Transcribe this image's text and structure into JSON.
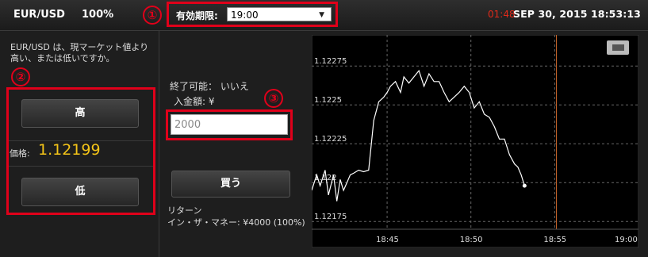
{
  "header": {
    "pair": "EUR/USD",
    "payout": "100%",
    "expiry_label": "有効期限:",
    "expiry_value": "19:00",
    "countdown": "01:48",
    "datetime": "SEP 30, 2015 18:53:13"
  },
  "markers": [
    "①",
    "②",
    "③"
  ],
  "left_panel": {
    "question": "EUR/USD は、現マーケット値より高い、または低いですか。",
    "high_label": "高",
    "price_label": "価格:",
    "price_value": "1.12199",
    "low_label": "低"
  },
  "middle_panel": {
    "expiry_possible": "終了可能： いいえ",
    "deposit_label": "入金額: ¥",
    "amount_value": "2000",
    "buy_label": "買う",
    "return_label": "リターン",
    "itm_label": "イン・ザ・マネー: ¥4000 (100%)"
  },
  "colors": {
    "accent_red": "#e0001a",
    "price_yellow": "#f5c518",
    "expiry_line": "#c8642a"
  },
  "chart_data": {
    "type": "line",
    "y_ticks": [
      "1.12275",
      "1.1225",
      "1.12225",
      "1.122",
      "1.12175"
    ],
    "y_tick_values": [
      1.12275,
      1.1225,
      1.12225,
      1.122,
      1.12175
    ],
    "x_ticks": [
      "18:45",
      "18:50",
      "18:55",
      "19:00"
    ],
    "ylim": [
      1.1217,
      1.12295
    ],
    "x_range_minutes": [
      40.5,
      60
    ],
    "expiry_marker": "19:00",
    "grid": true,
    "series": [
      {
        "x": [
          40.5,
          40.8,
          41.0,
          41.3,
          41.5,
          41.8,
          42.0,
          42.2,
          42.4,
          42.6,
          42.8,
          43.0,
          43.3,
          43.6,
          43.9,
          44.2,
          44.5,
          44.8,
          45.0,
          45.2,
          45.5,
          45.8,
          46.0,
          46.3,
          46.6,
          46.9,
          47.2,
          47.5,
          47.8,
          48.1,
          48.4,
          48.7,
          49.0,
          49.3,
          49.6,
          49.9,
          50.2,
          50.5,
          50.8,
          51.1,
          51.4,
          51.7,
          52.0,
          52.3,
          52.6,
          52.8,
          53.0,
          53.2
        ],
        "y": [
          1.12195,
          1.12205,
          1.12198,
          1.12208,
          1.12192,
          1.12205,
          1.12188,
          1.12202,
          1.12195,
          1.122,
          1.12205,
          1.12206,
          1.12208,
          1.12207,
          1.12208,
          1.1224,
          1.12252,
          1.12255,
          1.12258,
          1.12262,
          1.12265,
          1.12258,
          1.12268,
          1.12264,
          1.12268,
          1.12272,
          1.12262,
          1.1227,
          1.12265,
          1.12265,
          1.12258,
          1.12252,
          1.12255,
          1.12258,
          1.12262,
          1.12258,
          1.12248,
          1.12252,
          1.12244,
          1.12242,
          1.12236,
          1.12228,
          1.12228,
          1.12218,
          1.12212,
          1.1221,
          1.12205,
          1.12198
        ]
      }
    ]
  }
}
